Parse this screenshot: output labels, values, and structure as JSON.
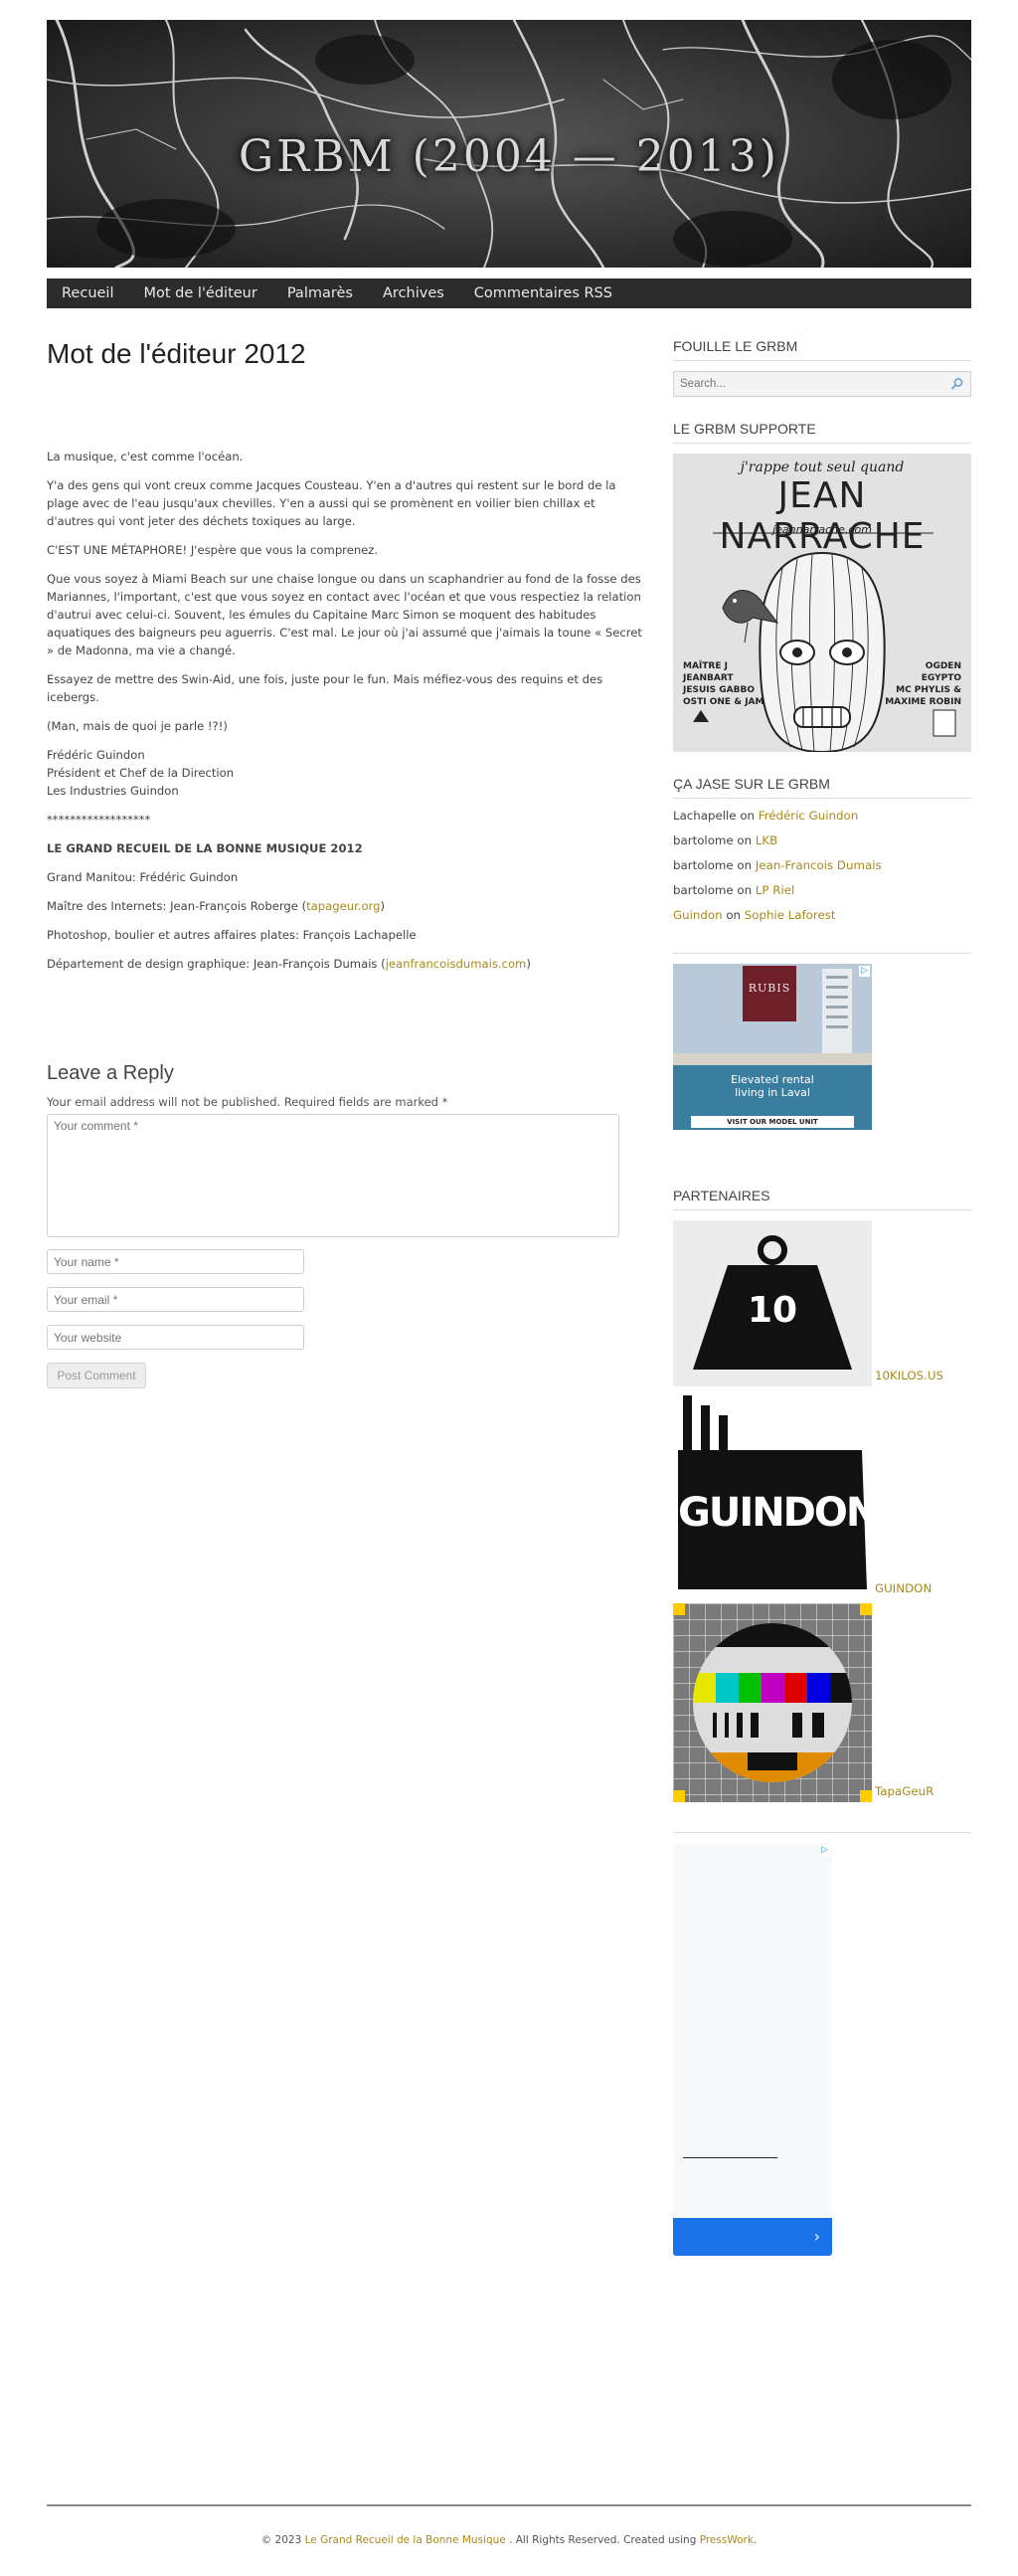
{
  "site": {
    "title": "GRBM (2004 — 2013)"
  },
  "nav": {
    "items": [
      {
        "label": "Recueil"
      },
      {
        "label": "Mot de l'éditeur"
      },
      {
        "label": "Palmarès"
      },
      {
        "label": "Archives"
      },
      {
        "label": "Commentaires RSS"
      }
    ]
  },
  "post": {
    "title": "Mot de l'éditeur 2012",
    "paragraphs": [
      "La musique, c'est comme l'océan.",
      "Y'a des gens qui vont creux comme Jacques Cousteau. Y'en a d'autres qui restent sur le bord de la plage avec de l'eau jusqu'aux chevilles. Y'en a aussi qui se promènent en voilier bien chillax et d'autres qui vont jeter des déchets toxiques au large.",
      "C'EST UNE MÉTAPHORE! J'espère que vous la comprenez.",
      "Que vous soyez à Miami Beach sur une chaise longue ou dans un scaphandrier au fond de la fosse des Mariannes, l'important, c'est que vous soyez en contact avec l'océan et que vous respectiez la relation d'autrui avec celui-ci. Souvent, les émules du Capitaine Marc Simon se moquent des habitudes aquatiques des baigneurs peu aguerris. C'est mal. Le jour où j'ai assumé que j'aimais la toune « Secret » de Madonna, ma vie a changé.",
      "Essayez de mettre des Swin-Aid, une fois, juste pour le fun. Mais méfiez-vous des requins et des icebergs.",
      "(Man, mais de quoi je parle !?!)"
    ],
    "signature": [
      "Frédéric Guindon",
      "Président et Chef de la Direction",
      "Les Industries Guindon"
    ],
    "stars": "******************",
    "credits_heading": "LE GRAND RECUEIL DE LA BONNE MUSIQUE 2012",
    "credit_manitou": "Grand Manitou: Frédéric Guindon",
    "credit_internet_prefix": "Maître des Internets: Jean-François Roberge (",
    "credit_internet_link": "tapageur.org",
    "credit_internet_suffix": ")",
    "credit_photoshop": "Photoshop, boulier et autres affaires plates: François Lachapelle",
    "credit_design_prefix": "Département de design graphique: Jean-François Dumais (",
    "credit_design_link": "jeanfrancoisdumais.com",
    "credit_design_suffix": ")"
  },
  "reply": {
    "title": "Leave a Reply",
    "notes": "Your email address will not be published. Required fields are marked *",
    "comment_placeholder": "Your comment *",
    "name_placeholder": "Your name *",
    "email_placeholder": "Your email *",
    "website_placeholder": "Your website",
    "submit_label": "Post Comment"
  },
  "sidebar": {
    "search_title": "FOUILLE LE GRBM",
    "search_placeholder": "Search...",
    "supporte_title": "LE GRBM SUPPORTE",
    "poster": {
      "tagline": "j'rappe tout seul quand",
      "name": "JEAN NARRACHE",
      "url": "jeannarrache.com",
      "left_names": [
        "MAÎTRE J",
        "JEANBART",
        "JESUIS GABBO",
        "OSTI ONE & JAM"
      ],
      "right_names": [
        "OGDEN",
        "EGYPTO",
        "MC PHYLIS &",
        "MAXIME ROBIN"
      ]
    },
    "jase_title": "ÇA JASE SUR LE GRBM",
    "comments": [
      {
        "author": "Lachapelle",
        "author_link": false,
        "on": "on",
        "post": "Frédéric Guindon"
      },
      {
        "author": "bartolome",
        "author_link": false,
        "on": "on",
        "post": "LKB"
      },
      {
        "author": "bartolome",
        "author_link": false,
        "on": "on",
        "post": "Jean-Francois Dumais"
      },
      {
        "author": "bartolome",
        "author_link": false,
        "on": "on",
        "post": "LP Riel"
      },
      {
        "author": "Guindon",
        "author_link": true,
        "on": "on",
        "post": "Sophie Laforest"
      }
    ],
    "ad1": {
      "brand": "RUBIS",
      "text": "Elevated rental living in Laval",
      "cta": "VISIT OUR MODEL UNIT"
    },
    "partners_title": "PARTENAIRES",
    "partners": [
      {
        "label": "10KILOS.US",
        "logo_text": "10"
      },
      {
        "label": "GUINDON",
        "logo_text": "GUINDON"
      },
      {
        "label": "TapaGeuR",
        "logo_text": ""
      }
    ]
  },
  "footer": {
    "prefix": "© 2023 ",
    "site_link": "Le Grand Recueil de la Bonne Musique",
    "middle": " . All Rights Reserved. Created using ",
    "theme_link": "PressWork",
    "suffix": "."
  },
  "colors": {
    "accent": "#a88a1b",
    "nav_bg": "#2b2b2b",
    "ad_blue": "#1a73e8"
  }
}
